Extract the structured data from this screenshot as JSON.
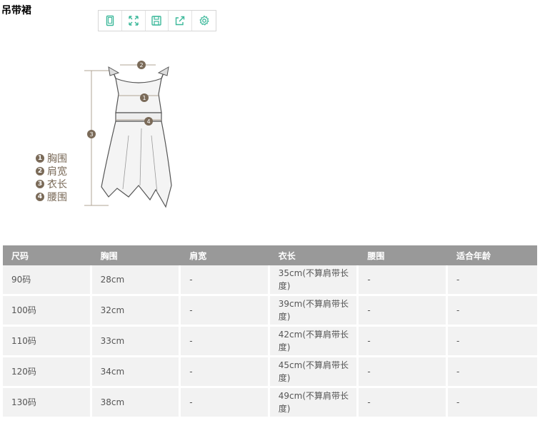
{
  "title": "吊带裙",
  "toolbar": {
    "buttons": [
      "tablet-icon",
      "expand-icon",
      "save-icon",
      "share-icon",
      "gear-icon"
    ]
  },
  "figure": {
    "markers": [
      "1",
      "2",
      "3",
      "4"
    ]
  },
  "legend": [
    {
      "num": "1",
      "label": "胸围"
    },
    {
      "num": "2",
      "label": "肩宽"
    },
    {
      "num": "3",
      "label": "衣长"
    },
    {
      "num": "4",
      "label": "腰围"
    }
  ],
  "table": {
    "headers": [
      "尺码",
      "胸围",
      "肩宽",
      "衣长",
      "腰围",
      "适合年龄"
    ],
    "rows": [
      [
        "90码",
        "28cm",
        "-",
        "35cm(不算肩带长度)",
        "-",
        "-"
      ],
      [
        "100码",
        "32cm",
        "-",
        "39cm(不算肩带长度)",
        "-",
        "-"
      ],
      [
        "110码",
        "33cm",
        "-",
        "42cm(不算肩带长度)",
        "-",
        "-"
      ],
      [
        "120码",
        "34cm",
        "-",
        "45cm(不算肩带长度)",
        "-",
        "-"
      ],
      [
        "130码",
        "38cm",
        "-",
        "49cm(不算肩带长度)",
        "-",
        "-"
      ]
    ]
  },
  "colors": {
    "accent": "#3bb89a",
    "header_bg": "#999999",
    "cell_bg": "#f2f2f2",
    "legend": "#7a6a58"
  }
}
